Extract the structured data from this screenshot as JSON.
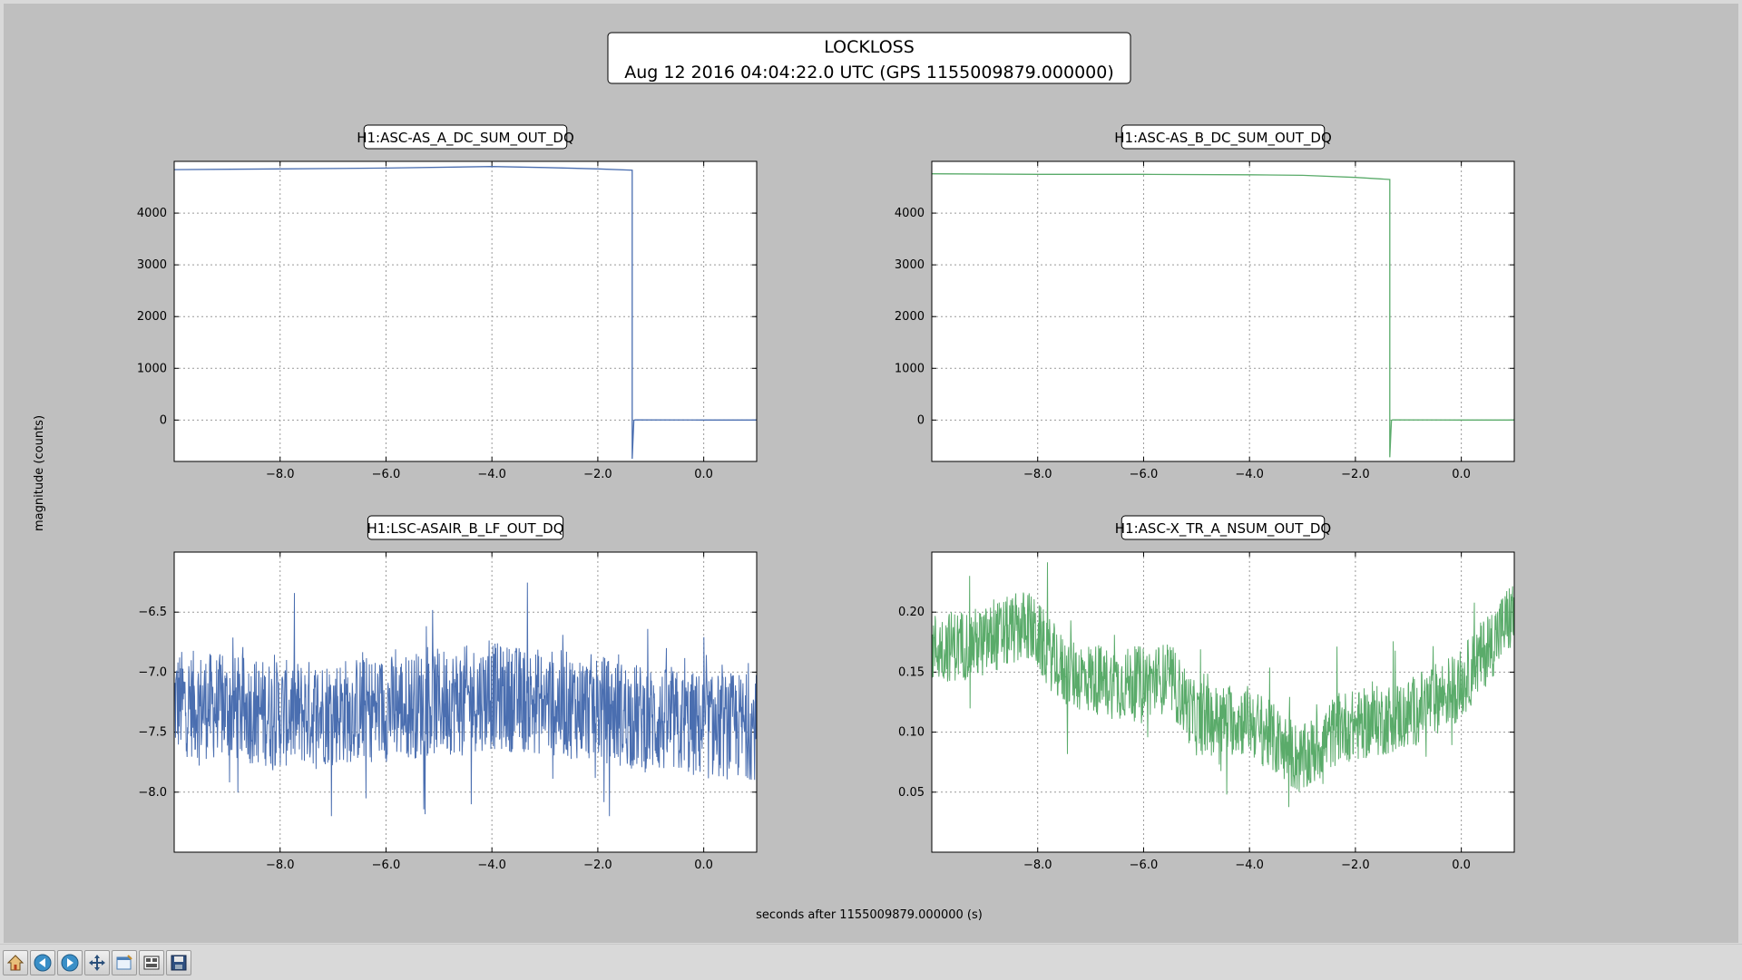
{
  "figure": {
    "title_line1": "LOCKLOSS",
    "title_line2": "Aug 12 2016 04:04:22.0 UTC (GPS 1155009879.000000)",
    "xlabel": "seconds after 1155009879.000000 (s)",
    "ylabel": "magnitude (counts)"
  },
  "toolbar": {
    "buttons": [
      {
        "name": "home-icon"
      },
      {
        "name": "back-arrow-icon"
      },
      {
        "name": "forward-arrow-icon"
      },
      {
        "name": "pan-move-icon"
      },
      {
        "name": "zoom-rect-icon"
      },
      {
        "name": "subplots-config-icon"
      },
      {
        "name": "save-floppy-icon"
      }
    ]
  },
  "chart_data": [
    {
      "type": "line",
      "title": "H1:ASC-AS_A_DC_SUM_OUT_DQ",
      "color": "#4a6eb0",
      "xlim": [
        -10,
        1
      ],
      "ylim": [
        -800,
        5000
      ],
      "xticks": [
        -8.0,
        -6.0,
        -4.0,
        -2.0,
        0.0
      ],
      "yticks": [
        0,
        1000,
        2000,
        3000,
        4000
      ],
      "grid": true,
      "series": [
        {
          "x": [
            -10,
            -8,
            -6,
            -4,
            -3,
            -2,
            -1.35,
            -1.35,
            -1.32,
            -1.3,
            0,
            1
          ],
          "y": [
            4840,
            4855,
            4870,
            4900,
            4880,
            4855,
            4830,
            -750,
            -10,
            5,
            0,
            0
          ]
        }
      ]
    },
    {
      "type": "line",
      "title": "H1:ASC-AS_B_DC_SUM_OUT_DQ",
      "color": "#5aab6a",
      "xlim": [
        -10,
        1
      ],
      "ylim": [
        -800,
        5000
      ],
      "xticks": [
        -8.0,
        -6.0,
        -4.0,
        -2.0,
        0.0
      ],
      "yticks": [
        0,
        1000,
        2000,
        3000,
        4000
      ],
      "grid": true,
      "series": [
        {
          "x": [
            -10,
            -8,
            -6,
            -4,
            -3,
            -2,
            -1.35,
            -1.35,
            -1.32,
            -1.3,
            0,
            1
          ],
          "y": [
            4760,
            4750,
            4750,
            4740,
            4730,
            4690,
            4650,
            -720,
            -10,
            5,
            0,
            0
          ]
        }
      ]
    },
    {
      "type": "line",
      "title": "H1:LSC-ASAIR_B_LF_OUT_DQ",
      "color": "#4a6eb0",
      "xlim": [
        -10,
        1
      ],
      "ylim": [
        -8.5,
        -6.0
      ],
      "xticks": [
        -8.0,
        -6.0,
        -4.0,
        -2.0,
        0.0
      ],
      "yticks": [
        -8.0,
        -7.5,
        -7.0,
        -6.5
      ],
      "grid": true,
      "series": [
        {
          "x": [
            -10,
            -8,
            -6,
            -4,
            -3,
            -2,
            -1,
            0,
            1
          ],
          "y": [
            -7.25,
            -7.35,
            -7.3,
            -7.2,
            -7.25,
            -7.3,
            -7.4,
            -7.45,
            -7.45
          ],
          "noise_band": 0.9
        }
      ]
    },
    {
      "type": "line",
      "title": "H1:ASC-X_TR_A_NSUM_OUT_DQ",
      "color": "#5aab6a",
      "xlim": [
        -10,
        1
      ],
      "ylim": [
        0,
        0.25
      ],
      "xticks": [
        -8.0,
        -6.0,
        -4.0,
        -2.0,
        0.0
      ],
      "yticks": [
        0.05,
        0.1,
        0.15,
        0.2
      ],
      "grid": true,
      "series": [
        {
          "x": [
            -10,
            -9,
            -8.2,
            -7.5,
            -6.5,
            -5.5,
            -5,
            -4,
            -3,
            -2.3,
            -2,
            -1,
            0,
            1
          ],
          "y": [
            0.17,
            0.175,
            0.19,
            0.15,
            0.14,
            0.145,
            0.11,
            0.11,
            0.075,
            0.105,
            0.105,
            0.115,
            0.14,
            0.2
          ],
          "noise_band": 0.06
        }
      ]
    }
  ]
}
